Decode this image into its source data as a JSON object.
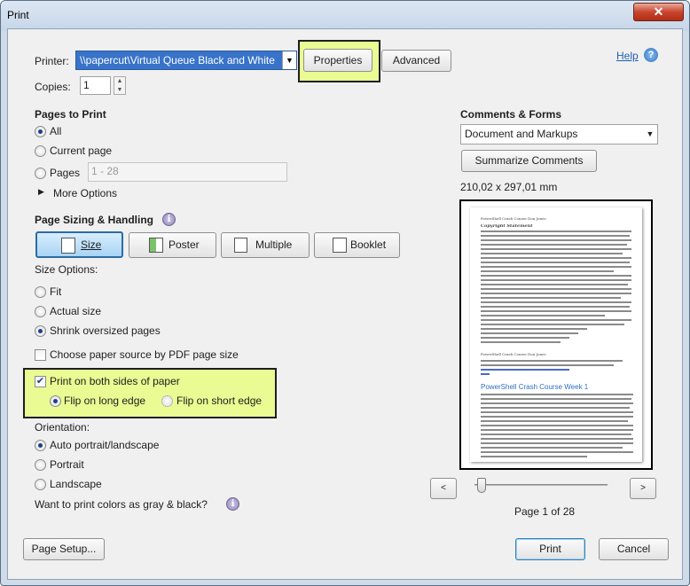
{
  "window": {
    "title": "Print",
    "close_glyph": "✕"
  },
  "printer": {
    "label": "Printer:",
    "value": "\\\\papercut\\Virtual Queue Black and White",
    "properties_label": "Properties",
    "advanced_label": "Advanced",
    "help_label": "Help"
  },
  "copies": {
    "label": "Copies:",
    "value": "1"
  },
  "pages_to_print": {
    "heading": "Pages to Print",
    "all": "All",
    "current_page": "Current page",
    "pages": "Pages",
    "pages_placeholder": "1 - 28",
    "more_options": "More Options"
  },
  "sizing": {
    "heading": "Page Sizing & Handling",
    "tabs": [
      {
        "label": "Size",
        "icon": "size-icon"
      },
      {
        "label": "Poster",
        "icon": "poster-icon"
      },
      {
        "label": "Multiple",
        "icon": "multiple-icon"
      },
      {
        "label": "Booklet",
        "icon": "booklet-icon"
      }
    ],
    "size_options_label": "Size Options:",
    "fit": "Fit",
    "actual_size": "Actual size",
    "shrink": "Shrink oversized pages",
    "paper_source": "Choose paper source by PDF page size",
    "duplex": "Print on both sides of paper",
    "flip_long": "Flip on long edge",
    "flip_short": "Flip on short edge"
  },
  "orientation": {
    "label": "Orientation:",
    "auto": "Auto portrait/landscape",
    "portrait": "Portrait",
    "landscape": "Landscape"
  },
  "gray_question": "Want to print colors as gray & black?",
  "comments": {
    "heading": "Comments & Forms",
    "value": "Document and Markups",
    "summarize": "Summarize Comments",
    "dimensions": "210,02 x 297,01 mm"
  },
  "preview": {
    "doc_title": "PowerShell Crash Course Week 1",
    "header_small": "PowerShell Crash Course Don Jones",
    "copyright_heading": "Copyright Statement",
    "page_indicator": "Page 1 of 28",
    "slider_position": 0.0
  },
  "footer": {
    "page_setup": "Page Setup...",
    "print": "Print",
    "cancel": "Cancel"
  },
  "colors": {
    "highlight": "#e9fb92",
    "link": "#1f5fb4",
    "selected_tab": "#bfe0f7"
  }
}
